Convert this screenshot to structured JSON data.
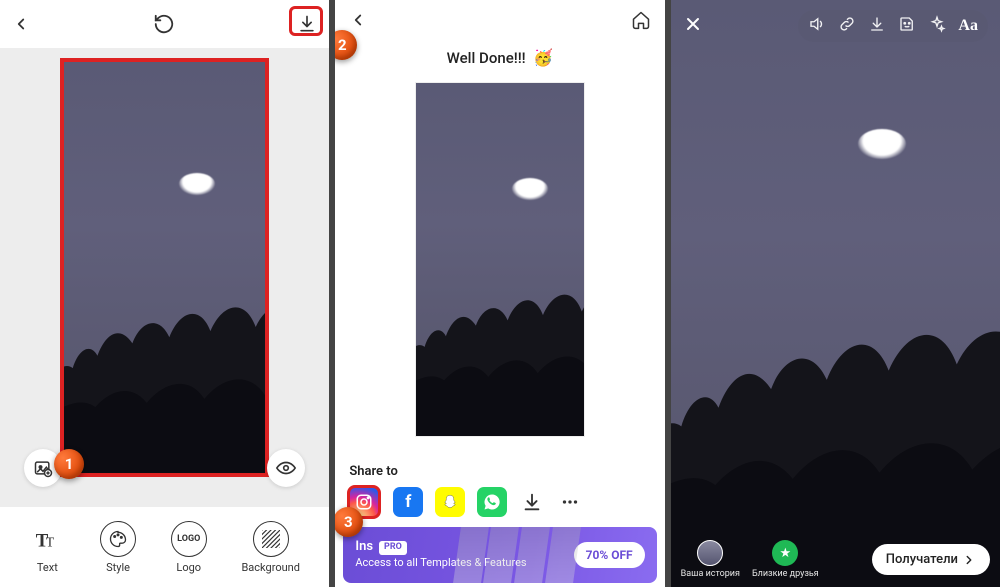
{
  "markers": {
    "m1": "1",
    "m2": "2",
    "m3": "3"
  },
  "panel1": {
    "tools": {
      "text": "Text",
      "style": "Style",
      "logo": "Logo",
      "background": "Background"
    }
  },
  "panel2": {
    "title": "Well Done!!!",
    "emoji": "🥳",
    "share_label": "Share to",
    "banner": {
      "title": "Ins",
      "badge": "PRO",
      "subtitle": "Access to all Templates & Features",
      "offer": "70% OFF"
    }
  },
  "panel3": {
    "your_story": "Ваша история",
    "close_friends": "Близкие друзья",
    "recipients": "Получатели",
    "text_tool": "Aa"
  }
}
